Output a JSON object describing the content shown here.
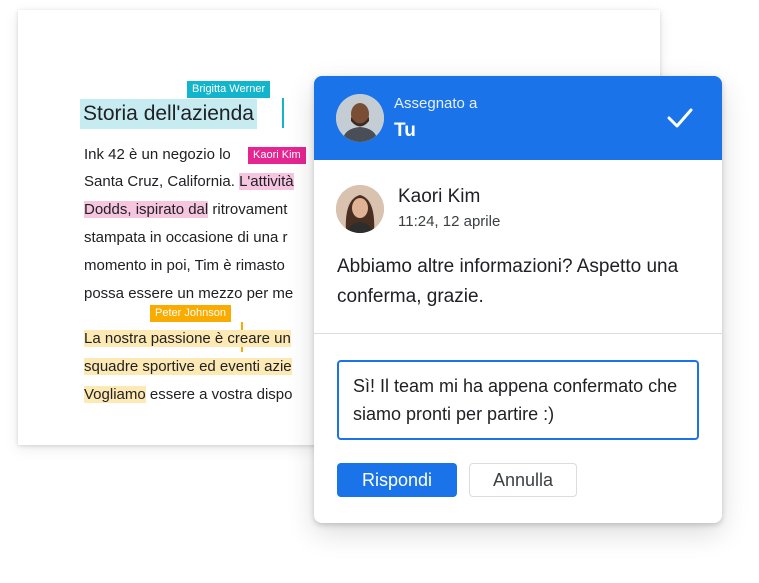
{
  "document": {
    "title": "Storia dell'azienda",
    "lines": [
      [
        "Ink 42 è un negozio lo",
        "",
        ""
      ],
      [
        "Santa Cruz, California. ",
        "L'attività",
        ""
      ],
      [
        "Dodds, ispirato dal",
        " ritrovament",
        ""
      ],
      [
        "stampata in occasione di una r",
        "",
        ""
      ],
      [
        "momento in poi, Tim è rimasto",
        "",
        ""
      ],
      [
        "possa essere un mezzo per me",
        "",
        ""
      ],
      [
        "La nostra passione è",
        " creare un",
        ""
      ],
      [
        "squadre sportive ed eventi azie",
        "",
        ""
      ],
      [
        "Vogliamo",
        " essere a vostra dispo",
        ""
      ]
    ],
    "collaborators": [
      {
        "name": "Brigitta Werner",
        "color": "#12b5cb"
      },
      {
        "name": "Kaori Kim",
        "color": "#e52592"
      },
      {
        "name": "Peter Johnson",
        "color": "#f9ab00"
      }
    ]
  },
  "comment_card": {
    "header": {
      "assigned_label": "Assegnato a",
      "assignee": "Tu",
      "accent_color": "#1a73e8",
      "resolve_icon": "check-icon"
    },
    "comment": {
      "author": "Kaori Kim",
      "timestamp": "11:24, 12 aprile",
      "text": "Abbiamo altre informazioni? Aspetto una conferma, grazie."
    },
    "reply": {
      "value": "Sì! Il team mi ha appena confermato che siamo pronti per partire :)"
    },
    "buttons": {
      "reply": "Rispondi",
      "cancel": "Annulla"
    }
  }
}
